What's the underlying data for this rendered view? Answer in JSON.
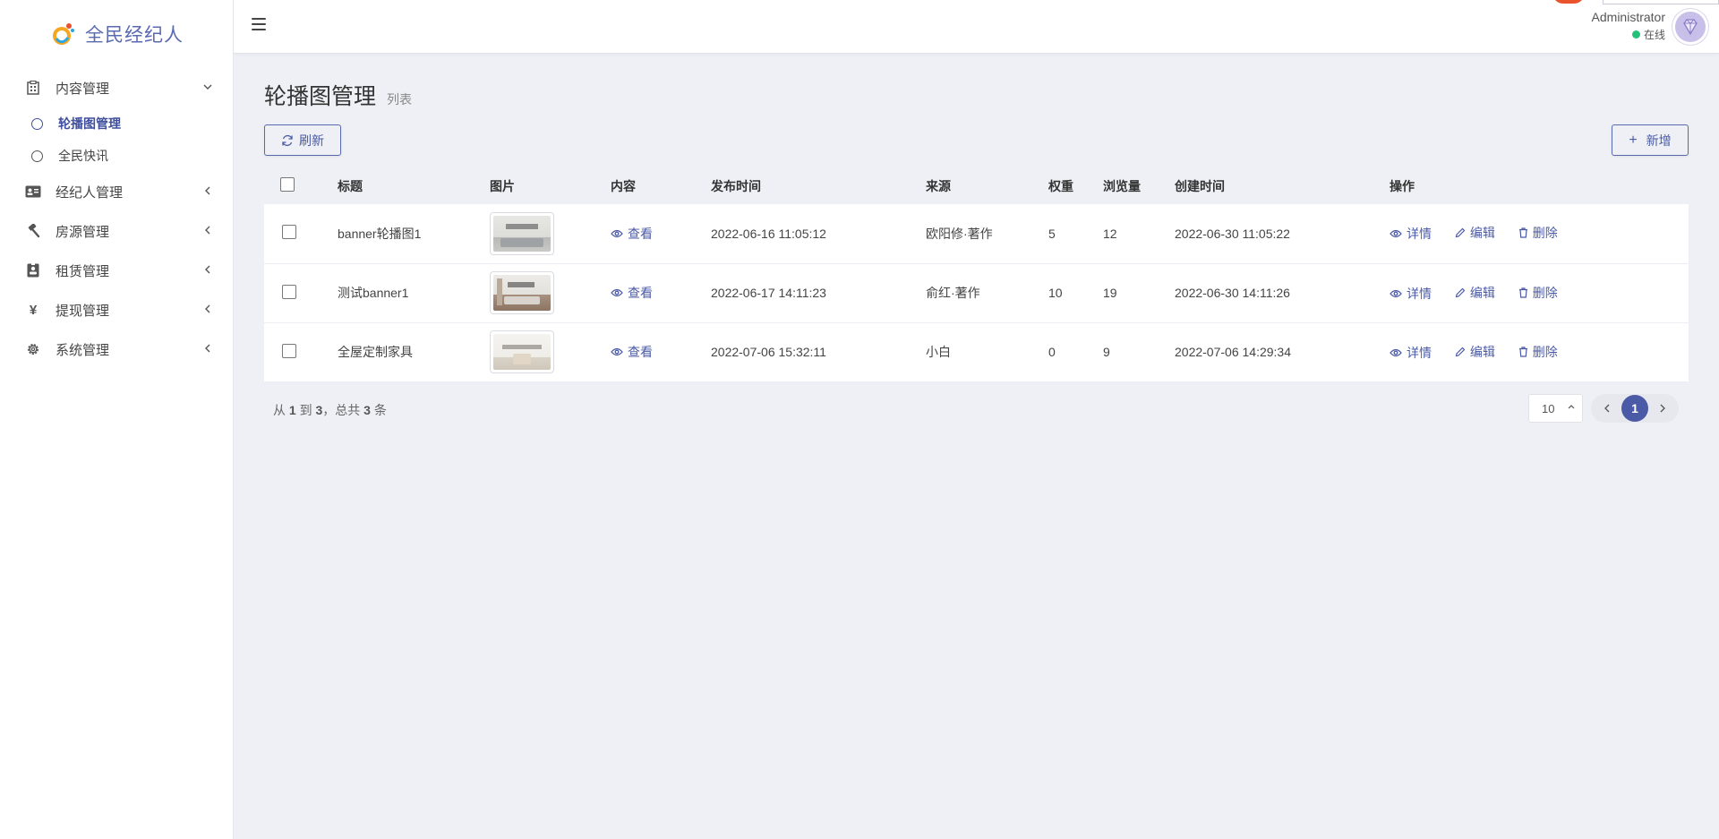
{
  "brand": {
    "name": "全民经纪人"
  },
  "sidebar": {
    "menu": [
      {
        "label": "内容管理",
        "icon": "building-icon",
        "expanded": true,
        "children": [
          {
            "label": "轮播图管理",
            "active": true
          },
          {
            "label": "全民快讯",
            "active": false
          }
        ]
      },
      {
        "label": "经纪人管理",
        "icon": "id-card-icon"
      },
      {
        "label": "房源管理",
        "icon": "gavel-icon"
      },
      {
        "label": "租赁管理",
        "icon": "contract-icon"
      },
      {
        "label": "提现管理",
        "icon": "yen-icon"
      },
      {
        "label": "系统管理",
        "icon": "gear-icon"
      }
    ]
  },
  "header": {
    "user": {
      "name": "Administrator",
      "status": "在线"
    }
  },
  "page": {
    "title": "轮播图管理",
    "subtitle": "列表",
    "refresh_label": "刷新",
    "add_label": "新增"
  },
  "table": {
    "columns": [
      "标题",
      "图片",
      "内容",
      "发布时间",
      "来源",
      "权重",
      "浏览量",
      "创建时间",
      "操作"
    ],
    "rows": [
      {
        "title": "banner轮播图1",
        "content": "查看",
        "publish_time": "2022-06-16 11:05:12",
        "source": "欧阳修·著作",
        "weight": "5",
        "views": "12",
        "created": "2022-06-30 11:05:22",
        "thumb": "living-room-gray"
      },
      {
        "title": "测试banner1",
        "content": "查看",
        "publish_time": "2022-06-17 14:11:23",
        "source": "俞红·著作",
        "weight": "10",
        "views": "19",
        "created": "2022-06-30 14:11:26",
        "thumb": "living-room-wood"
      },
      {
        "title": "全屋定制家具",
        "content": "查看",
        "publish_time": "2022-07-06 15:32:11",
        "source": "小白",
        "weight": "0",
        "views": "9",
        "created": "2022-07-06 14:29:34",
        "thumb": "living-room-white"
      }
    ],
    "actions": {
      "detail": "详情",
      "edit": "编辑",
      "delete": "删除"
    }
  },
  "pagination": {
    "info_from": "从",
    "start": "1",
    "info_to": "到",
    "end": "3",
    "info_total": "，总共",
    "total": "3",
    "info_unit": "条",
    "page_size": "10",
    "current_page": "1"
  },
  "colors": {
    "accent": "#4a5aa6",
    "online": "#25c17a",
    "background": "#eef0f5"
  }
}
